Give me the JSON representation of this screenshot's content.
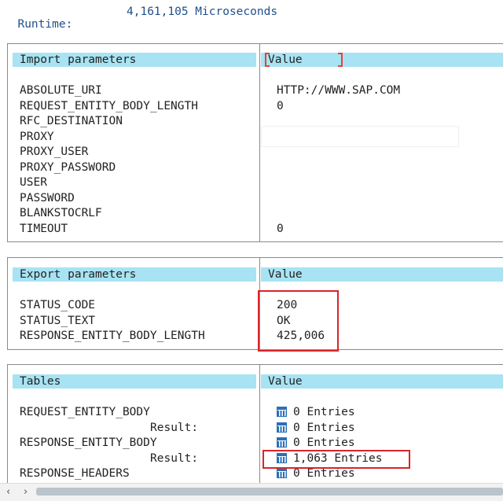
{
  "runtime": {
    "label": "Runtime:",
    "value": "4,161,105 Microseconds"
  },
  "import": {
    "header_left": "Import parameters",
    "header_right": "Value",
    "rows": [
      {
        "name": "ABSOLUTE_URI",
        "value": "HTTP://WWW.SAP.COM"
      },
      {
        "name": "REQUEST_ENTITY_BODY_LENGTH",
        "value": "0"
      },
      {
        "name": "RFC_DESTINATION",
        "value": ""
      },
      {
        "name": "PROXY",
        "value": ""
      },
      {
        "name": "PROXY_USER",
        "value": ""
      },
      {
        "name": "PROXY_PASSWORD",
        "value": ""
      },
      {
        "name": "USER",
        "value": ""
      },
      {
        "name": "PASSWORD",
        "value": ""
      },
      {
        "name": "BLANKSTOCRLF",
        "value": ""
      },
      {
        "name": "TIMEOUT",
        "value": "0"
      }
    ]
  },
  "export": {
    "header_left": "Export parameters",
    "header_right": "Value",
    "rows": [
      {
        "name": "STATUS_CODE",
        "value": "200"
      },
      {
        "name": "STATUS_TEXT",
        "value": "OK"
      },
      {
        "name": "RESPONSE_ENTITY_BODY_LENGTH",
        "value": "425,006"
      }
    ]
  },
  "tables": {
    "header_left": "Tables",
    "header_right": "Value",
    "rows": [
      {
        "name": "REQUEST_ENTITY_BODY",
        "value": "0 Entries"
      },
      {
        "name": "Result:",
        "value": "0 Entries"
      },
      {
        "name": "RESPONSE_ENTITY_BODY",
        "value": "0 Entries"
      },
      {
        "name": "Result:",
        "value": "1,063 Entries"
      },
      {
        "name": "RESPONSE_HEADERS",
        "value": "0 Entries"
      }
    ]
  },
  "colors": {
    "header_bg": "#a7e3f3",
    "highlight": "#d9252b",
    "runtime_text": "#1f4f8a"
  },
  "icons": {
    "table_entries": "table-grid-icon",
    "scroll_left": "chevron-left-icon",
    "scroll_right": "chevron-right-icon"
  }
}
